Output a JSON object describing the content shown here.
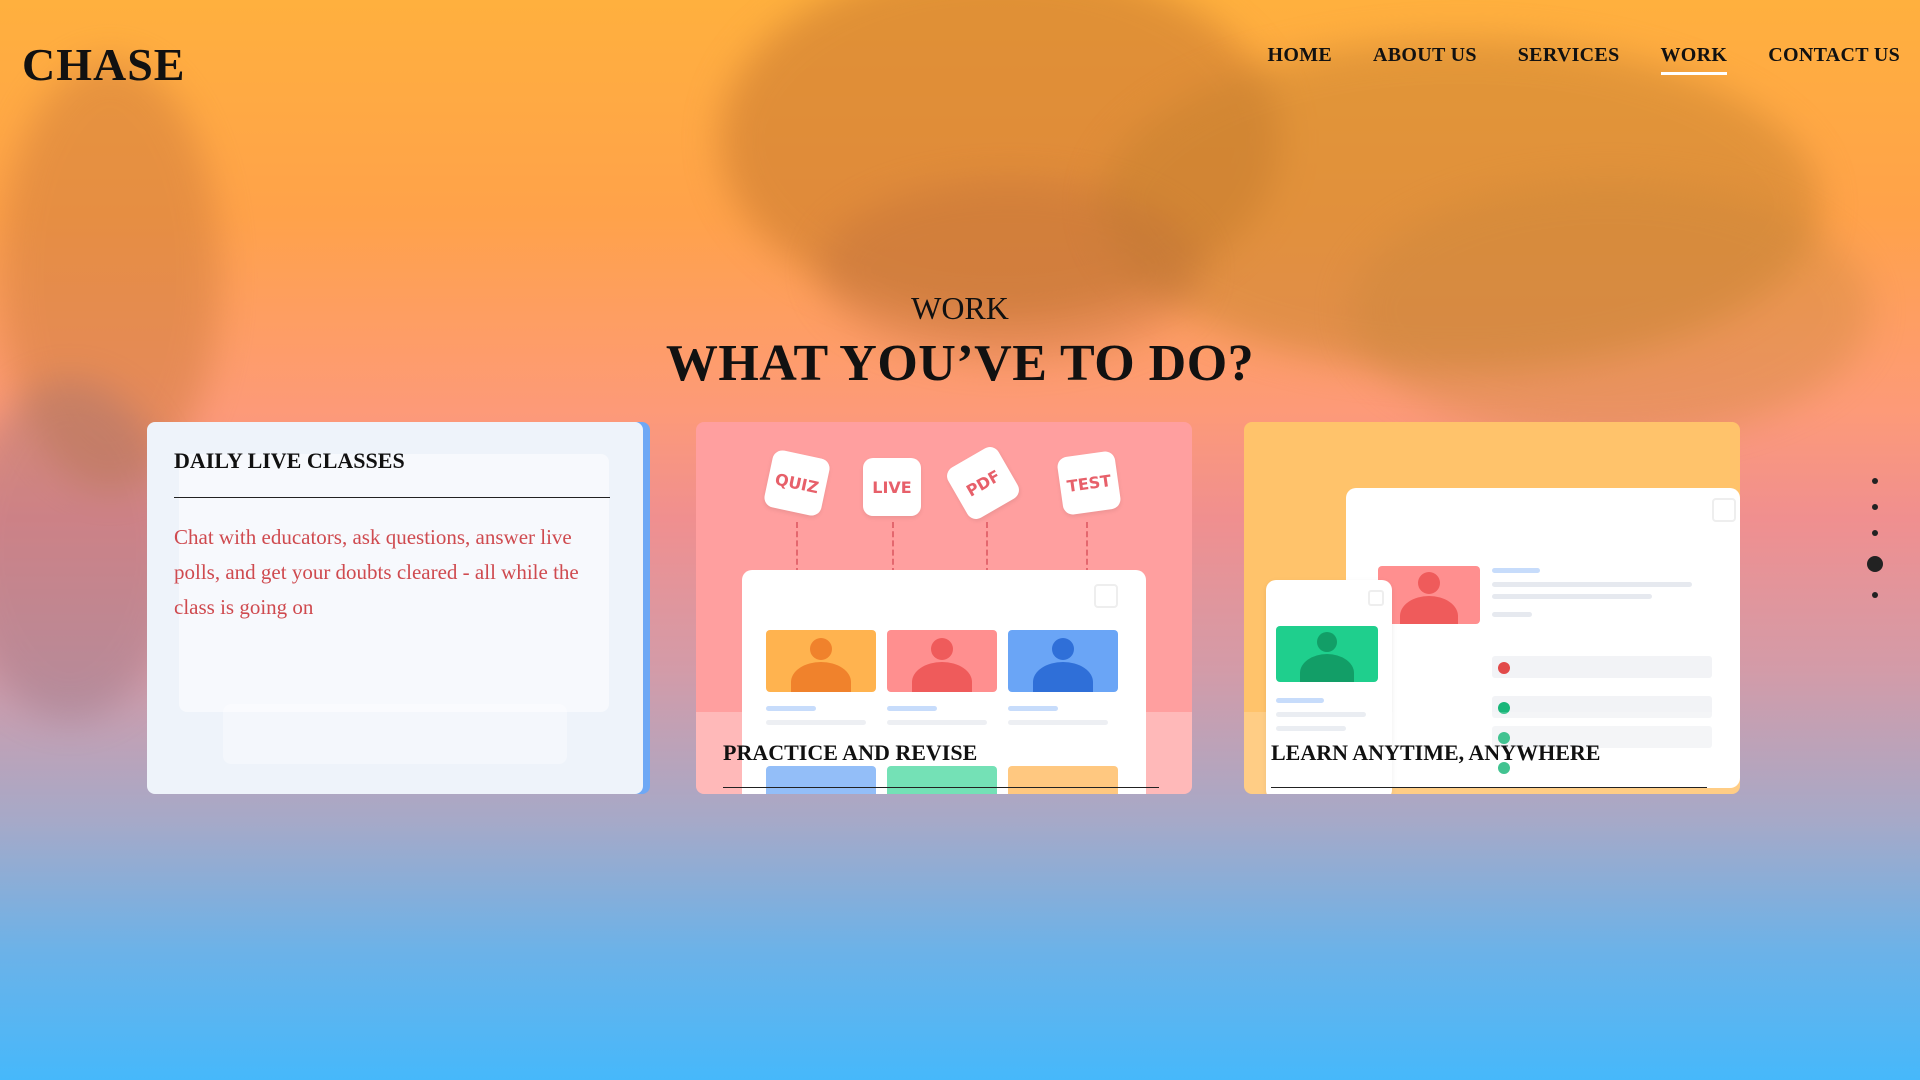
{
  "header": {
    "logo": "CHASE",
    "nav": [
      {
        "label": "HOME",
        "active": false
      },
      {
        "label": "ABOUT US",
        "active": false
      },
      {
        "label": "SERVICES",
        "active": false
      },
      {
        "label": "WORK",
        "active": true
      },
      {
        "label": "CONTACT US",
        "active": false
      }
    ]
  },
  "section": {
    "label": "WORK",
    "title": "WHAT YOU’VE TO DO?"
  },
  "cards": [
    {
      "title": "DAILY LIVE CLASSES",
      "description": "Chat with educators, ask questions, answer live polls, and get your doubts cleared - all while the class is going on",
      "color": "#eef3fa",
      "accent": "#6ea8f5"
    },
    {
      "title": "PRACTICE AND REVISE",
      "tags": [
        "QUIZ",
        "LIVE",
        "PDF",
        "TEST"
      ],
      "color": "#ff9f9f"
    },
    {
      "title": "LEARN ANYTIME, ANYWHERE",
      "color": "#ffc36b"
    }
  ],
  "pagination": {
    "count": 5,
    "active_index": 3
  },
  "colors": {
    "gradient_top": "#ffb03e",
    "gradient_bottom": "#46b8fb",
    "description_text": "#cf4a4f"
  }
}
